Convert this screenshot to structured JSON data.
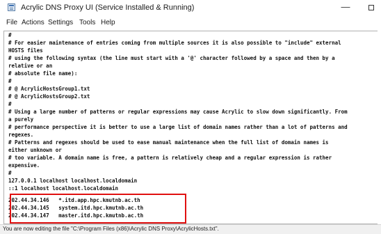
{
  "window": {
    "title": "Acrylic DNS Proxy UI (Service Installed & Running)",
    "minimize_glyph": "—"
  },
  "menu": [
    "File",
    "Actions",
    "Settings",
    "Tools",
    "Help"
  ],
  "editor": {
    "lines": [
      "#",
      "# For easier maintenance of entries coming from multiple sources it is also possible to \"include\" external",
      "HOSTS files",
      "# using the following syntax (the line must start with a '@' character followed by a space and then by a",
      "relative or an",
      "# absolute file name):",
      "#",
      "# @ AcrylicHostsGroup1.txt",
      "# @ AcrylicHostsGroup2.txt",
      "#",
      "# Using a large number of patterns or regular expressions may cause Acrylic to slow down significantly. From",
      "a purely",
      "# performance perspective it is better to use a large list of domain names rather than a lot of patterns and",
      "regexes.",
      "# Patterns and regexes should be used to ease manual maintenance when the full list of domain names is",
      "either unknown or",
      "# too variable. A domain name is free, a pattern is relatively cheap and a regular expression is rather",
      "expensive.",
      "#",
      "127.0.0.1 localhost localhost.localdomain",
      "::1 localhost localhost.localdomain",
      "202.44.34.146   *.itd.app.hpc.kmutnb.ac.th",
      "202.44.34.145   system.itd.hpc.kmutnb.ac.th",
      "202.44.34.147   master.itd.hpc.kmutnb.ac.th"
    ]
  },
  "status": {
    "text": "You are now editing the file \"C:\\Program Files (x86)\\Acrylic DNS Proxy\\AcrylicHosts.txt\"."
  },
  "colors": {
    "highlight": "#e01010",
    "status_background": "#f0f0f0"
  },
  "icons": {
    "app": "app-window-icon",
    "maximize": "maximize-icon"
  }
}
